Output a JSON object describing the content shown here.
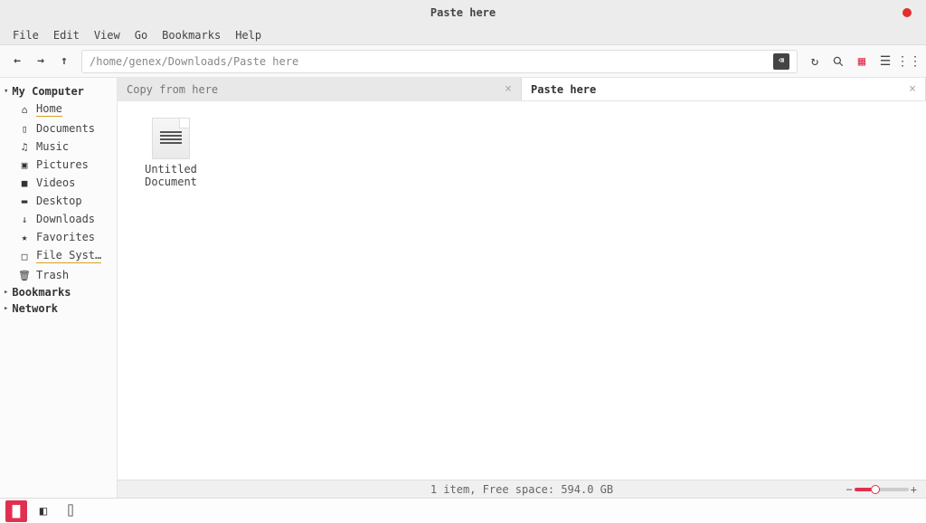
{
  "window": {
    "title": "Paste here"
  },
  "menubar": [
    "File",
    "Edit",
    "View",
    "Go",
    "Bookmarks",
    "Help"
  ],
  "pathbar": {
    "path": "/home/genex/Downloads/Paste here"
  },
  "sidebar": {
    "sections": {
      "computer": {
        "label": "My Computer",
        "items": [
          {
            "icon": "home-icon",
            "glyph": "⌂",
            "label": "Home",
            "underline": true
          },
          {
            "icon": "documents-icon",
            "glyph": "▯",
            "label": "Documents"
          },
          {
            "icon": "music-icon",
            "glyph": "♫",
            "label": "Music"
          },
          {
            "icon": "pictures-icon",
            "glyph": "▣",
            "label": "Pictures"
          },
          {
            "icon": "videos-icon",
            "glyph": "■",
            "label": "Videos"
          },
          {
            "icon": "desktop-icon",
            "glyph": "▬",
            "label": "Desktop"
          },
          {
            "icon": "downloads-icon",
            "glyph": "↓",
            "label": "Downloads"
          },
          {
            "icon": "favorites-icon",
            "glyph": "★",
            "label": "Favorites"
          },
          {
            "icon": "filesystem-icon",
            "glyph": "□",
            "label": "File Syst…",
            "underline": true
          },
          {
            "icon": "trash-icon",
            "glyph": "🗑",
            "label": "Trash"
          }
        ]
      },
      "bookmarks": {
        "label": "Bookmarks"
      },
      "network": {
        "label": "Network"
      }
    }
  },
  "tabs": [
    {
      "label": "Copy from here",
      "active": false
    },
    {
      "label": "Paste here",
      "active": true
    }
  ],
  "files": [
    {
      "label": "Untitled\nDocument"
    }
  ],
  "statusbar": {
    "text": "1 item, Free space: 594.0 GB"
  }
}
